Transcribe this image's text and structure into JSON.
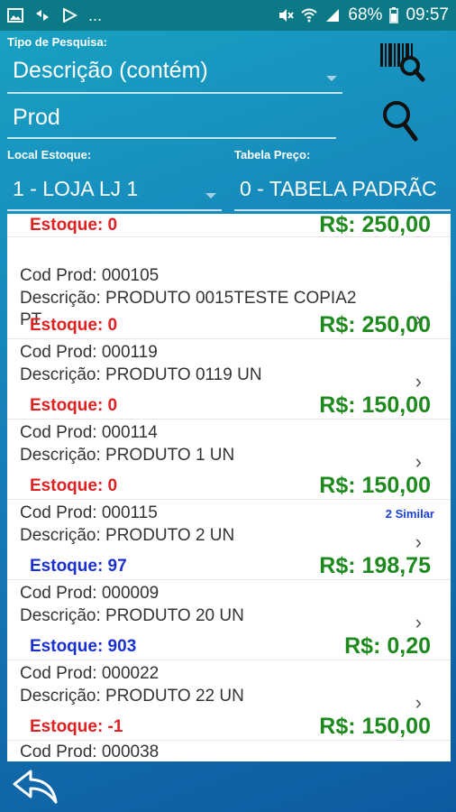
{
  "status_bar": {
    "dots": "...",
    "battery": "68%",
    "time": "09:57"
  },
  "search": {
    "type_label": "Tipo de Pesquisa:",
    "type_value": "Descrição (contém)",
    "query_value": "Prod"
  },
  "filters": {
    "stock_label": "Local Estoque:",
    "stock_value": "1 - LOJA LJ 1",
    "price_label": "Tabela Preço:",
    "price_value": "0 - TABELA PADRÃC"
  },
  "list": {
    "first": {
      "stock": "Estoque: 0",
      "price": "R$: 250,00"
    },
    "items": [
      {
        "code": "Cod Prod: 000105",
        "desc": "Descrição: PRODUTO 0015TESTE COPIA2 PT",
        "stock": "Estoque: 0",
        "price": "R$: 250,00",
        "similar": ""
      },
      {
        "code": "Cod Prod: 000119",
        "desc": "Descrição: PRODUTO 0119 UN",
        "stock": "Estoque: 0",
        "price": "R$: 150,00",
        "similar": ""
      },
      {
        "code": "Cod Prod: 000114",
        "desc": "Descrição: PRODUTO 1 UN",
        "stock": "Estoque: 0",
        "price": "R$: 150,00",
        "similar": ""
      },
      {
        "code": "Cod Prod: 000115",
        "desc": "Descrição: PRODUTO 2 UN",
        "stock": "Estoque: 97",
        "price": "R$: 198,75",
        "similar": "2 Similar"
      },
      {
        "code": "Cod Prod: 000009",
        "desc": "Descrição: PRODUTO 20 UN",
        "stock": "Estoque: 903",
        "price": "R$: 0,20",
        "similar": ""
      },
      {
        "code": "Cod Prod: 000022",
        "desc": "Descrição: PRODUTO 22 UN",
        "stock": "Estoque: -1",
        "price": "R$: 150,00",
        "similar": ""
      },
      {
        "code": "Cod Prod: 000038",
        "desc": "",
        "stock": "",
        "price": "",
        "similar": ""
      }
    ]
  },
  "colors": {
    "stock_zero": "#e02020",
    "stock_positive": "#1a2fd0",
    "price": "#1e8a1e",
    "similar": "#1a3fd0"
  },
  "icons": {
    "barcode_search": "barcode-search-icon",
    "search": "search-icon",
    "back": "back-arrow-icon"
  }
}
